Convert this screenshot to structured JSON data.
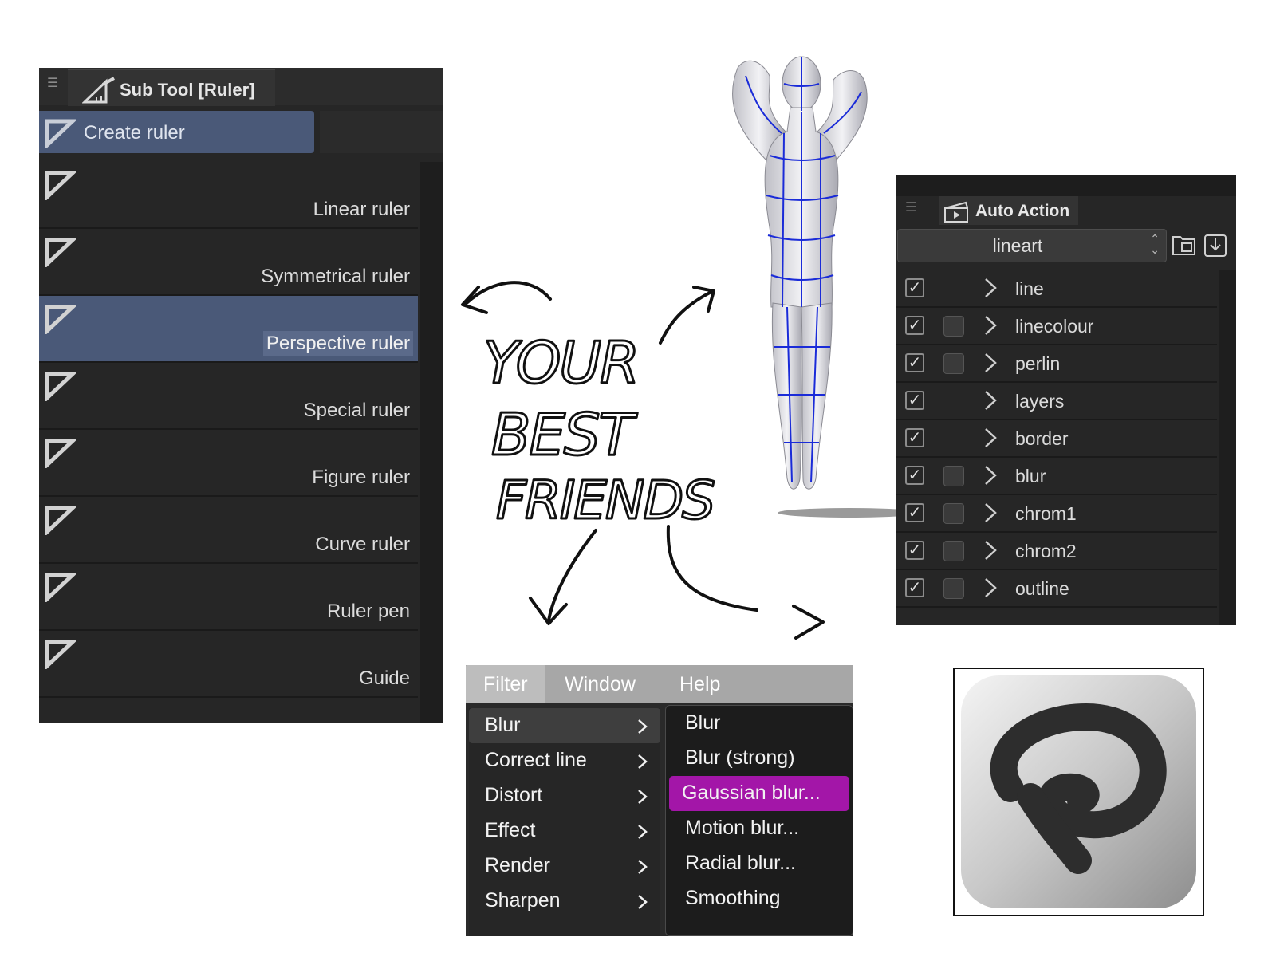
{
  "subtool": {
    "title": "Sub Tool [Ruler]",
    "create_label": "Create ruler",
    "items": [
      {
        "label": "Linear ruler",
        "selected": false
      },
      {
        "label": "Symmetrical ruler",
        "selected": false
      },
      {
        "label": "Perspective ruler",
        "selected": true
      },
      {
        "label": "Special ruler",
        "selected": false
      },
      {
        "label": "Figure ruler",
        "selected": false
      },
      {
        "label": "Curve ruler",
        "selected": false
      },
      {
        "label": "Ruler pen",
        "selected": false
      },
      {
        "label": "Guide",
        "selected": false
      }
    ]
  },
  "caption": {
    "line1": "YOUR",
    "line2": "BEST",
    "line3": "FRIENDS"
  },
  "autoaction": {
    "title": "Auto Action",
    "set_name": "lineart",
    "rows": [
      {
        "name": "line",
        "checked": true,
        "dialog_box": false
      },
      {
        "name": "linecolour",
        "checked": true,
        "dialog_box": true
      },
      {
        "name": "perlin",
        "checked": true,
        "dialog_box": true
      },
      {
        "name": "layers",
        "checked": true,
        "dialog_box": false
      },
      {
        "name": "border",
        "checked": true,
        "dialog_box": false
      },
      {
        "name": "blur",
        "checked": true,
        "dialog_box": true
      },
      {
        "name": "chrom1",
        "checked": true,
        "dialog_box": true
      },
      {
        "name": "chrom2",
        "checked": true,
        "dialog_box": true
      },
      {
        "name": "outline",
        "checked": true,
        "dialog_box": true
      }
    ]
  },
  "filter_menu": {
    "menubar": [
      "Filter",
      "Window",
      "Help"
    ],
    "categories": [
      "Blur",
      "Correct line",
      "Distort",
      "Effect",
      "Render",
      "Sharpen"
    ],
    "blur_submenu": [
      "Blur",
      "Blur (strong)",
      "Gaussian blur...",
      "Motion blur...",
      "Radial blur...",
      "Smoothing"
    ],
    "highlighted_item": "Gaussian blur...",
    "highlight_color": "#a316a8"
  },
  "colors": {
    "panel_bg": "#262626",
    "selection_blue": "#4a5978",
    "figure_grid": "#1a2bd8"
  }
}
